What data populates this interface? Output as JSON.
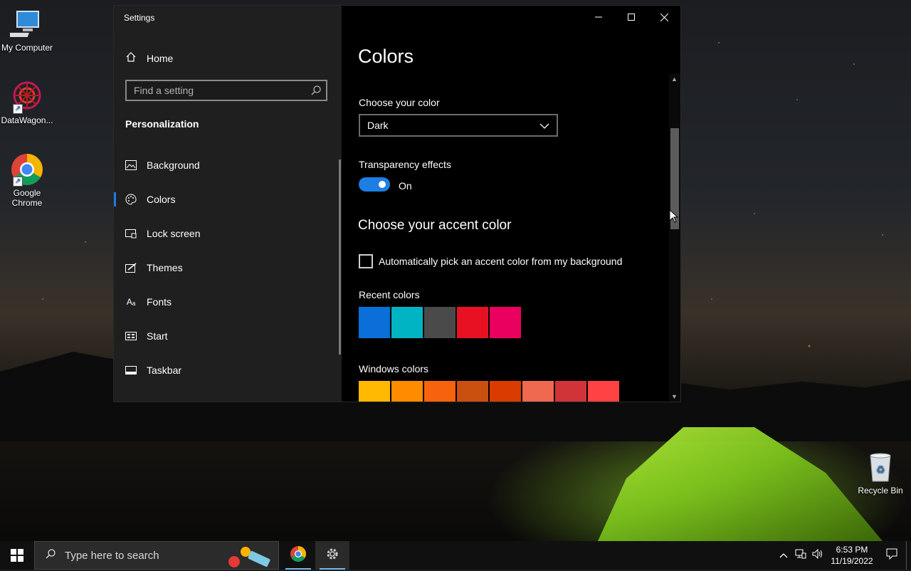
{
  "desktop": {
    "icons": [
      {
        "label": "My Computer"
      },
      {
        "label": "DataWagon..."
      },
      {
        "label": "Google Chrome"
      },
      {
        "label": "Recycle Bin"
      }
    ]
  },
  "window": {
    "title": "Settings",
    "home_label": "Home",
    "search_placeholder": "Find a setting",
    "section_title": "Personalization",
    "nav": [
      {
        "label": "Background",
        "icon": "image-icon"
      },
      {
        "label": "Colors",
        "icon": "palette-icon"
      },
      {
        "label": "Lock screen",
        "icon": "lock-screen-icon"
      },
      {
        "label": "Themes",
        "icon": "themes-icon"
      },
      {
        "label": "Fonts",
        "icon": "fonts-icon"
      },
      {
        "label": "Start",
        "icon": "start-icon"
      },
      {
        "label": "Taskbar",
        "icon": "taskbar-icon"
      }
    ],
    "active_nav": "Colors"
  },
  "content": {
    "title": "Colors",
    "choose_color_label": "Choose your color",
    "choose_color_value": "Dark",
    "transparency_label": "Transparency effects",
    "transparency_state": "On",
    "accent_heading": "Choose your accent color",
    "auto_pick_label": "Automatically pick an accent color from my background",
    "auto_pick_checked": false,
    "recent_colors_label": "Recent colors",
    "recent_colors": [
      "#0a6fd8",
      "#00b4c4",
      "#4a4a4a",
      "#e81123",
      "#ea005e"
    ],
    "windows_colors_label": "Windows colors",
    "windows_colors": [
      "#ffb900",
      "#ff8c00",
      "#f7630c",
      "#ca5010",
      "#da3b01",
      "#ef6950",
      "#d13438",
      "#ff4343"
    ]
  },
  "taskbar": {
    "search_placeholder": "Type here to search",
    "time": "6:53 PM",
    "date": "11/19/2022"
  },
  "colors": {
    "accent": "#1d7ee3",
    "window_bg": "#000000",
    "sidebar_bg": "#1f1f1f",
    "taskbar_bg": "#101010"
  }
}
